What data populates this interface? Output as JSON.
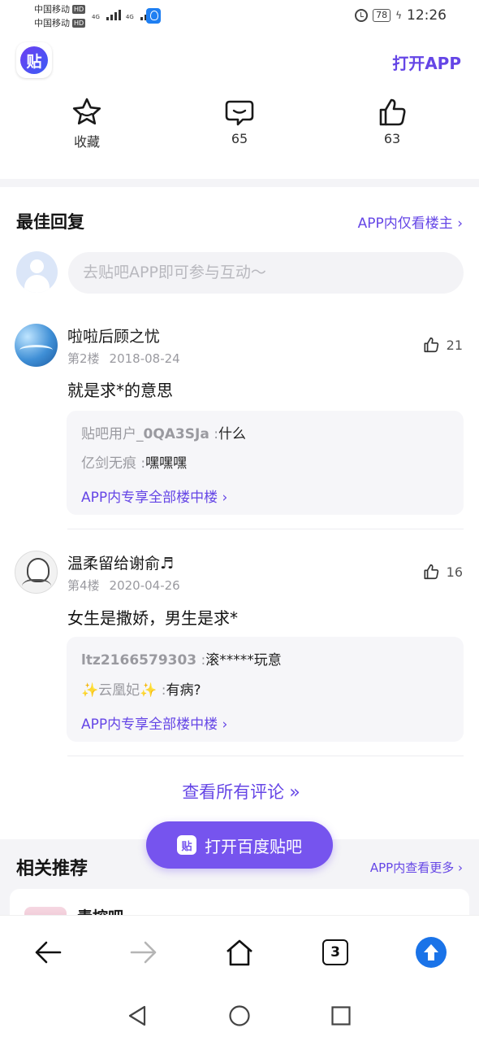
{
  "status_bar": {
    "carrier1": "中国移动",
    "carrier2": "中国移动",
    "hd": "HD",
    "network": "4G",
    "battery": "78",
    "time": "12:26"
  },
  "header": {
    "logo_text": "贴",
    "open_app": "打开APP"
  },
  "stats": {
    "favorite_label": "收藏",
    "comments_count": "65",
    "likes_count": "63"
  },
  "best_replies": {
    "title": "最佳回复",
    "only_host": "APP内仅看楼主 ›",
    "compose_placeholder": "去贴吧APP即可参与互动～"
  },
  "posts": [
    {
      "username": "啦啦后顾之忧",
      "floor": "第2楼",
      "date": "2018-08-24",
      "likes": "21",
      "content": "就是求*的意思",
      "subreplies": [
        {
          "who": "贴吧用户_",
          "who_bold": "0QA3SJa",
          "sep": " :",
          "text": "什么"
        },
        {
          "who": "亿剑无痕",
          "who_bold": "",
          "sep": " :",
          "text": "嘿嘿嘿"
        }
      ],
      "more": "APP内专享全部楼中楼 ›"
    },
    {
      "username": "温柔留给谢俞♬",
      "floor": "第4楼",
      "date": "2020-04-26",
      "likes": "16",
      "content": "女生是撒娇，男生是求*",
      "subreplies": [
        {
          "who": "",
          "who_bold": "ltz2166579303",
          "sep": " :",
          "text": "滚*****玩意"
        },
        {
          "who": "云凰妃",
          "who_bold": "",
          "sep": " :",
          "text": "有病?"
        }
      ],
      "more": "APP内专享全部楼中楼 ›"
    }
  ],
  "view_all": "查看所有评论",
  "related": {
    "title": "相关推荐",
    "more": "APP内查看更多 ›",
    "first_item": "青控吧"
  },
  "float_button": {
    "badge": "贴",
    "label": "打开百度贴吧"
  },
  "browser": {
    "tabs_count": "3"
  }
}
